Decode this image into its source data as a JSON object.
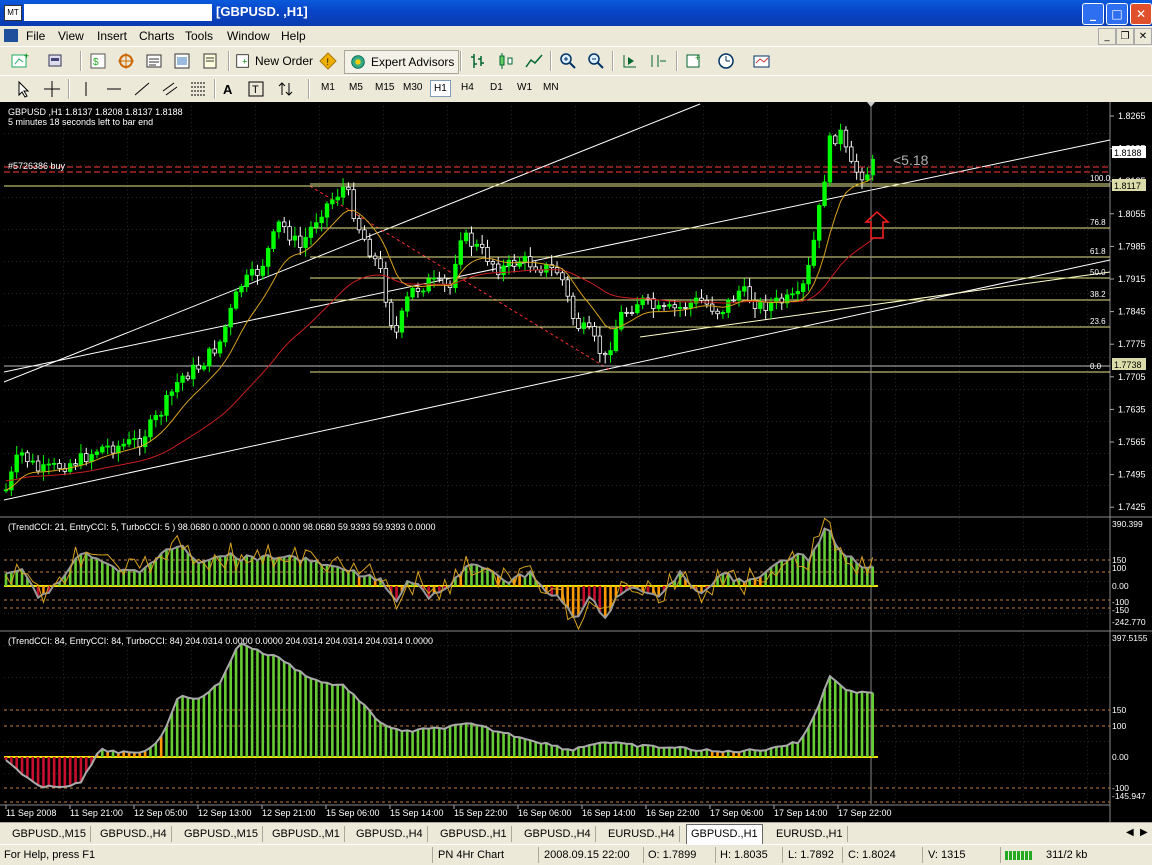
{
  "window": {
    "title": "[GBPUSD. ,H1]",
    "app_icon_label": "MT",
    "minimize": "_",
    "maximize": "□",
    "close": "✕"
  },
  "menu": {
    "items": [
      "File",
      "View",
      "Insert",
      "Charts",
      "Tools",
      "Window",
      "Help"
    ]
  },
  "mdi": {
    "minimize": "_",
    "restore": "❐",
    "close": "✕"
  },
  "toolbar1": {
    "new_order": "New Order",
    "expert_advisors": "Expert Advisors"
  },
  "timeframes": [
    "M1",
    "M5",
    "M15",
    "M30",
    "H1",
    "H4",
    "D1",
    "W1",
    "MN"
  ],
  "active_timeframe": "H1",
  "chart": {
    "info_line": "GBPUSD ,H1  1.8137 1.8208 1.8137 1.8188",
    "bar_timer": "5 minutes 18 seconds left to bar end",
    "order_label": "#5726386 buy",
    "pips_label": "<5.18",
    "current_price": "1.8188",
    "fib_low_price": "1.7738",
    "fib_high_price": "1.8117",
    "price_ticks": [
      "1.8265",
      "1.8195",
      "1.8125",
      "1.8055",
      "1.7985",
      "1.7915",
      "1.7845",
      "1.7775",
      "1.7705",
      "1.7635",
      "1.7565",
      "1.7495",
      "1.7425"
    ],
    "fib_levels": [
      "100.0",
      "76.8",
      "61.8",
      "50.0",
      "38.2",
      "23.6",
      "0.0"
    ],
    "colors": {
      "bull_candle": "#00ff00",
      "bear_candle": "#ffffff",
      "fast_ma": "#d7a21e",
      "slow_ma": "#c81e1e",
      "fib": "#e6e68c",
      "channel": "#ffffff",
      "order_line": "#ff3c3c"
    }
  },
  "indicator1": {
    "label": "(TrendCCI: 21, EntryCCI: 5, TurboCCI: 5 )  98.0680 0.0000 0.0000 0.0000 98.0680 59.9393 59.9393 0.0000",
    "ticks": [
      "390.399",
      "150",
      "100",
      "0.00",
      "-100",
      "-150",
      "-242.770"
    ]
  },
  "indicator2": {
    "label": "(TrendCCI: 84, EntryCCI: 84, TurboCCI: 84)  204.0314 0.0000 0.0000 204.0314 204.0314 204.0314 0.0000",
    "ticks": [
      "397.5155",
      "150",
      "100",
      "0.00",
      "-100",
      "-145.947"
    ]
  },
  "time_axis": [
    "11 Sep 2008",
    "11 Sep 21:00",
    "12 Sep 05:00",
    "12 Sep 13:00",
    "12 Sep 21:00",
    "15 Sep 06:00",
    "15 Sep 14:00",
    "15 Sep 22:00",
    "16 Sep 06:00",
    "16 Sep 14:00",
    "16 Sep 22:00",
    "17 Sep 06:00",
    "17 Sep 14:00",
    "17 Sep 22:00"
  ],
  "tabs": [
    "GBPUSD.,M15",
    "GBPUSD.,H4",
    "GBPUSD.,M15",
    "GBPUSD.,M1",
    "GBPUSD.,H4",
    "GBPUSD.,H1",
    "GBPUSD.,H4",
    "EURUSD.,H4",
    "GBPUSD.,H1",
    "EURUSD.,H1"
  ],
  "active_tab": 8,
  "status": {
    "help": "For Help, press F1",
    "profile": "PN 4Hr Chart",
    "datetime": "2008.09.15 22:00",
    "open": "O: 1.7899",
    "high": "H: 1.8035",
    "low": "L: 1.7892",
    "close": "C: 1.8024",
    "volume": "V: 1315",
    "traffic": "311/2 kb"
  }
}
